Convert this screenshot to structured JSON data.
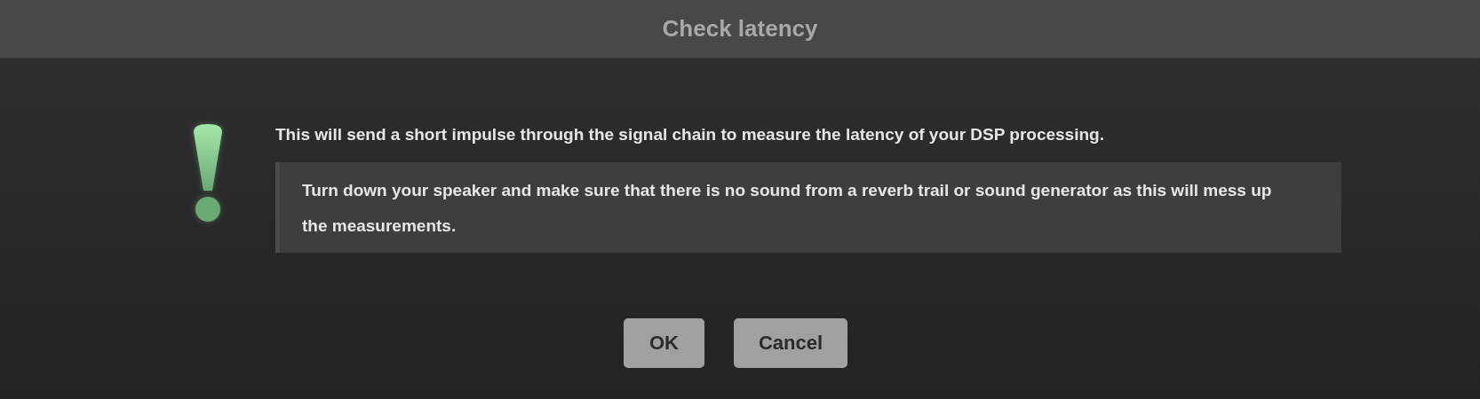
{
  "window": {
    "title": "Check latency"
  },
  "message": "This will send a short impulse through the signal chain to measure the latency of your DSP processing.",
  "note": "Turn down your speaker and make sure that there is no sound from a reverb trail or sound generator as this will mess up the measurements.",
  "buttons": [
    "OK",
    "Cancel"
  ]
}
